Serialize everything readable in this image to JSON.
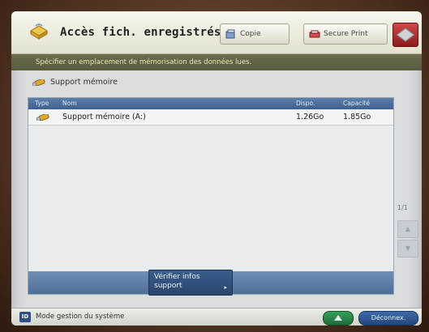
{
  "header": {
    "title": "Accès fich. enregistrés",
    "tabs": [
      {
        "label": "Copie",
        "icon": "copy-icon"
      },
      {
        "label": "Secure Print",
        "icon": "secure-print-icon"
      }
    ],
    "menu_icon": "main-menu-icon"
  },
  "instruction": "Spécifier un emplacement de mémorisation des données lues.",
  "breadcrumb": {
    "label": "Support mémoire",
    "icon": "usb-stick-icon"
  },
  "table": {
    "columns": [
      "Type",
      "Nom",
      "Dispo.",
      "Capacité"
    ],
    "rows": [
      {
        "icon": "usb-stick-icon",
        "name": "Support mémoire (A:)",
        "dispo": "1.26Go",
        "capacite": "1.85Go"
      }
    ]
  },
  "verify_button": {
    "line1": "Vérifier infos",
    "line2": "support",
    "arrow": "▸"
  },
  "pager": {
    "page": "1/1"
  },
  "status_bar": {
    "badge": "ID",
    "text": "Mode gestion du système",
    "logout_label": "Déconnex."
  },
  "colors": {
    "header_bg": "#efede0",
    "instruction_bg": "#626347",
    "list_header_bg": "#4f6f98",
    "footer_bg": "#5f7fa7",
    "menu_button": "#b03030"
  }
}
